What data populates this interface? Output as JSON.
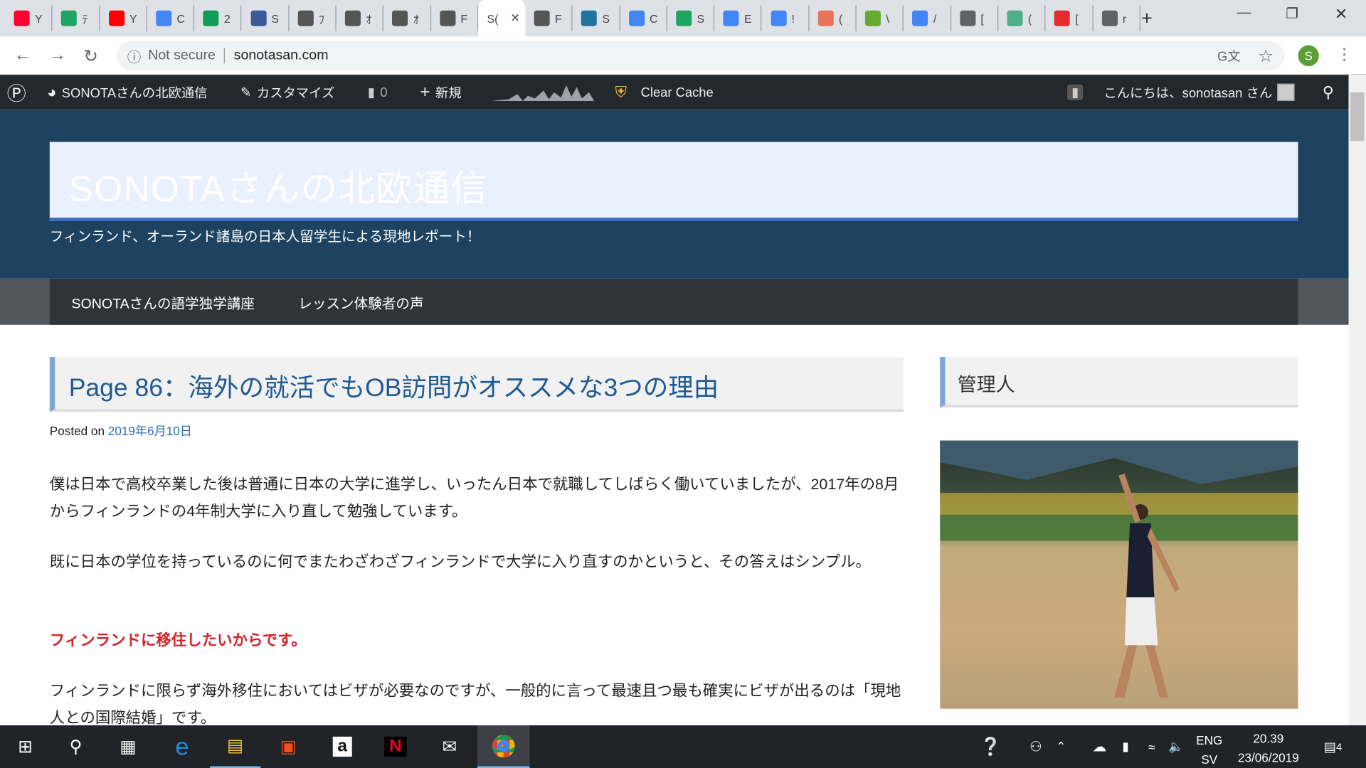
{
  "browser": {
    "tabs": [
      {
        "icon": "yahoo-icon",
        "label": "Y",
        "color": "#ff0033"
      },
      {
        "icon": "google-drive-icon",
        "label": "ﾃ",
        "color": "#1fa463"
      },
      {
        "icon": "youtube-icon",
        "label": "Y",
        "color": "#ff0000"
      },
      {
        "icon": "google-calendar-icon",
        "label": "C",
        "color": "#4285f4"
      },
      {
        "icon": "google-sheets-icon",
        "label": "2",
        "color": "#0f9d58"
      },
      {
        "icon": "facebook-icon",
        "label": "S",
        "color": "#3b5998"
      },
      {
        "icon": "photo-icon",
        "label": "ﾌ",
        "color": "#555"
      },
      {
        "icon": "photo-icon",
        "label": "ｵ",
        "color": "#555"
      },
      {
        "icon": "photo-icon",
        "label": "ｵ",
        "color": "#555"
      },
      {
        "icon": "photo-icon",
        "label": "F",
        "color": "#555"
      },
      {
        "icon": "site-icon",
        "label": "S(",
        "color": "#fff",
        "active": true
      },
      {
        "icon": "photo-icon",
        "label": "F",
        "color": "#555"
      },
      {
        "icon": "wordpress-icon",
        "label": "S",
        "color": "#21759b"
      },
      {
        "icon": "google-icon",
        "label": "C",
        "color": "#4285f4"
      },
      {
        "icon": "google-drive-icon",
        "label": "S",
        "color": "#1fa463"
      },
      {
        "icon": "google-docs-icon",
        "label": "E",
        "color": "#4285f4"
      },
      {
        "icon": "google-docs-icon",
        "label": "!",
        "color": "#4285f4"
      },
      {
        "icon": "circle-icon",
        "label": "(",
        "color": "#e8735a"
      },
      {
        "icon": "maco-icon",
        "label": "\\",
        "color": "#6a3"
      },
      {
        "icon": "google-docs-icon",
        "label": "/",
        "color": "#4285f4"
      },
      {
        "icon": "globe-icon",
        "label": "[",
        "color": "#5f6368"
      },
      {
        "icon": "diamond-icon",
        "label": "(",
        "color": "#4caf87"
      },
      {
        "icon": "red-app-icon",
        "label": "[",
        "color": "#e52b2b"
      },
      {
        "icon": "globe-icon",
        "label": "r",
        "color": "#5f6368"
      }
    ],
    "new_tab": "+",
    "security": "Not secure",
    "url": "sonotasan.com",
    "profile_initial": "S"
  },
  "adminbar": {
    "site_name": "SONOTAさんの北欧通信",
    "customize": "カスタマイズ",
    "comments": "0",
    "new": "新規",
    "clear_cache": "Clear Cache",
    "greeting": "こんにちは、sonotasan さん"
  },
  "site": {
    "title": "SONOTAさんの北欧通信",
    "tagline": "フィンランド、オーランド諸島の日本人留学生による現地レポート！",
    "nav": [
      "SONOTAさんの語学独学講座",
      "レッスン体験者の声"
    ]
  },
  "post": {
    "title": "Page 86：海外の就活でもOB訪問がオススメな3つの理由",
    "posted_on": "Posted on",
    "date": "2019年6月10日",
    "p1": "僕は日本で高校卒業した後は普通に日本の大学に進学し、いったん日本で就職してしばらく働いていましたが、2017年の8月からフィンランドの4年制大学に入り直して勉強しています。",
    "p2": "既に日本の学位を持っているのに何でまたわざわざフィンランドで大学に入り直すのかというと、その答えはシンプル。",
    "p3": "フィンランドに移住したいからです。",
    "p4": "フィンランドに限らず海外移住においてはビザが必要なのですが、一般的に言って最速且つ最も確実にビザが出るのは「現地人との国際結婚」です。"
  },
  "sidebar": {
    "widget_title": "管理人"
  },
  "taskbar": {
    "lang": "ENG",
    "layout": "SV",
    "time": "20.39",
    "date": "23/06/2019",
    "notifications": "4"
  }
}
